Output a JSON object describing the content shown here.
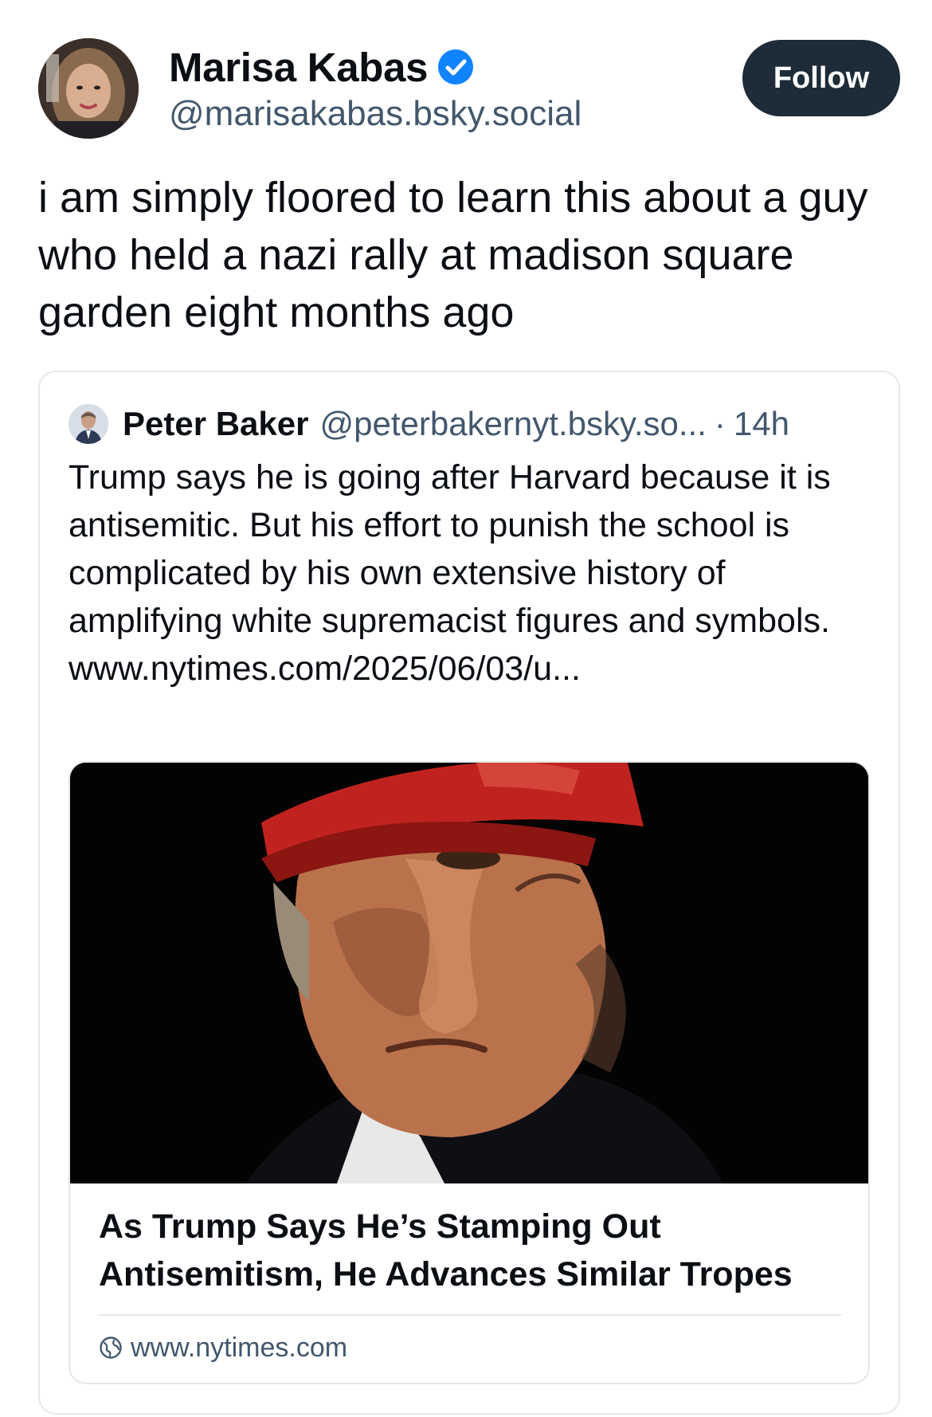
{
  "post": {
    "author": {
      "display_name": "Marisa Kabas",
      "handle": "@marisakabas.bsky.social",
      "verified": true
    },
    "follow_label": "Follow",
    "text": "i am simply floored to learn this about a guy who held a nazi rally at madison square garden eight months ago"
  },
  "quote": {
    "author": {
      "display_name": "Peter Baker",
      "handle": "@peterbakernyt.bsky.so..."
    },
    "separator": "·",
    "time": "14h",
    "text": "Trump says he is going after Harvard because it is antisemitic. But his effort to punish the school is complicated by his own extensive history of amplifying white supremacist figures and symbols. www.nytimes.com/2025/06/03/u...",
    "link_card": {
      "title": "As Trump Says He’s Stamping Out Antisemitism, He Advances Similar Tropes",
      "domain": "www.nytimes.com"
    }
  },
  "colors": {
    "text_primary": "#0b0f14",
    "text_secondary": "#42576c",
    "follow_button_bg": "#1e2b38",
    "verified_blue": "#1083fe",
    "border": "#e3e8ee"
  },
  "icons": {
    "verified": "verified-check-icon",
    "link_domain": "globe-icon"
  }
}
